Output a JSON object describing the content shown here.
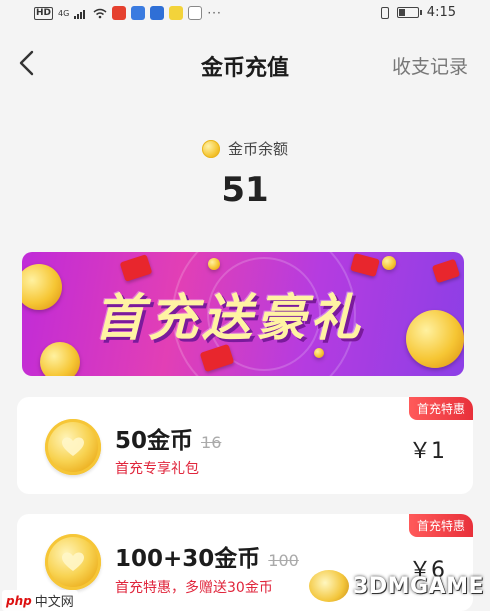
{
  "status_bar": {
    "hd": "HD",
    "signal": "4G",
    "more": "···",
    "time": "4:15",
    "battery_level": 0.35
  },
  "header": {
    "title": "金币充值",
    "records_label": "收支记录"
  },
  "balance": {
    "label": "金币余额",
    "value": "51"
  },
  "banner": {
    "text": "首充送豪礼"
  },
  "packages": [
    {
      "name": "50金币",
      "original": "16",
      "desc": "首充专享礼包",
      "tag": "首充特惠",
      "price": "￥1"
    },
    {
      "name": "100+30金币",
      "original": "100",
      "desc": "首充特惠，多赠送30金币",
      "tag": "首充特惠",
      "price": "￥6"
    }
  ],
  "watermarks": {
    "left_php": "php",
    "left_text": "中文网",
    "right_text": "3DMGAME"
  },
  "colors": {
    "accent_red": "#e0263c",
    "banner_purple": "#c02bd8",
    "coin_gold": "#f4c430"
  }
}
